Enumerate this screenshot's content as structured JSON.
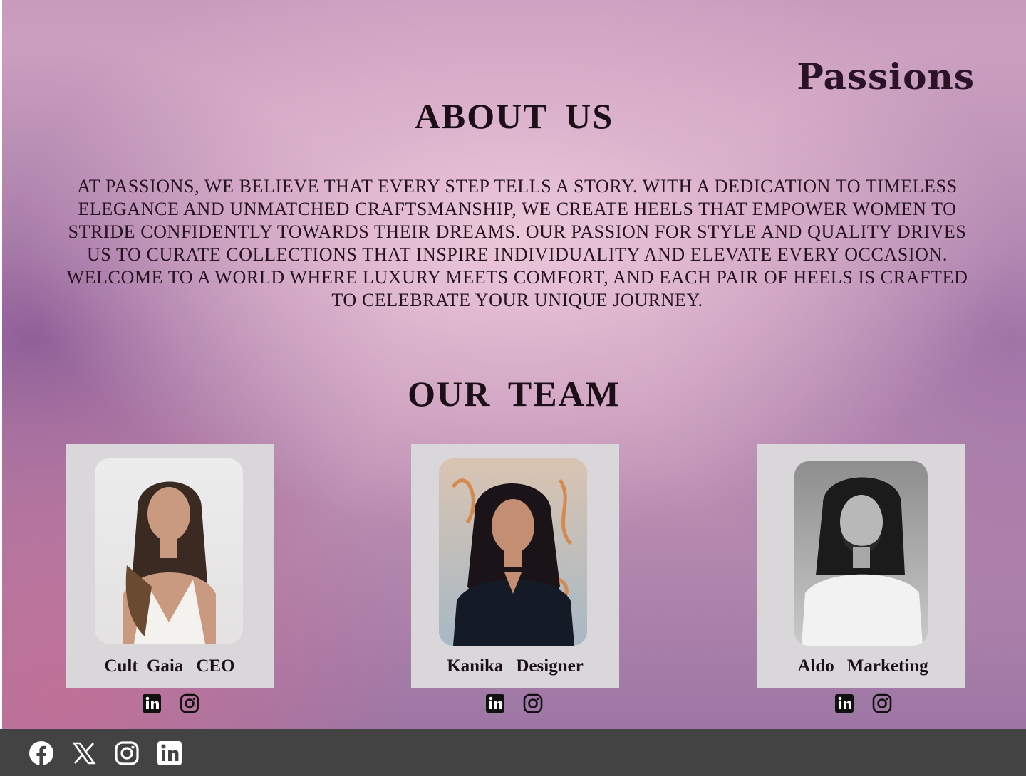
{
  "brand": {
    "logo_text": "Passions"
  },
  "about": {
    "heading": "ABOUT  US",
    "text": "At Passions, we believe that every step tells a story. With a dedication to timeless elegance and unmatched craftsmanship, we create heels that empower women to stride confidently towards their dreams. Our passion for style and quality drives us to curate collections that inspire individuality and elevate every occasion. Welcome to a world where luxury meets comfort, and each pair of heels is crafted to celebrate your unique journey."
  },
  "team": {
    "heading": "OUR  TEAM",
    "members": [
      {
        "name": "Cult Gaia",
        "role": "CEO"
      },
      {
        "name": "Kanika",
        "role": "Designer"
      },
      {
        "name": "Aldo",
        "role": "Marketing"
      }
    ]
  },
  "footer": {
    "icons": [
      "facebook-icon",
      "x-icon",
      "instagram-icon",
      "linkedin-icon"
    ]
  },
  "colors": {
    "card_bg": "#d9d7d9",
    "footer_bg": "#444343",
    "text_dark": "#1c0f18"
  }
}
